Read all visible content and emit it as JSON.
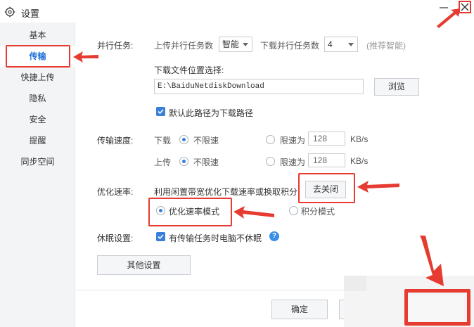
{
  "window": {
    "title": "设置"
  },
  "sidebar": {
    "items": [
      {
        "label": "基本"
      },
      {
        "label": "传输"
      },
      {
        "label": "快捷上传"
      },
      {
        "label": "隐私"
      },
      {
        "label": "安全"
      },
      {
        "label": "提醒"
      },
      {
        "label": "同步空间"
      }
    ],
    "active_index": 1
  },
  "parallel": {
    "label": "并行任务:",
    "upload_label": "上传并行任务数",
    "upload_value": "智能",
    "download_label": "下载并行任务数",
    "download_value": "4",
    "hint": "(推荐智能)"
  },
  "download_location": {
    "label": "下载文件位置选择:",
    "path": "E:\\BaiduNetdiskDownload",
    "browse_button": "浏览",
    "default_checkbox_label": "默认此路径为下载路径",
    "default_checked": true
  },
  "speed": {
    "label": "传输速度:",
    "download_label": "下载",
    "upload_label": "上传",
    "unlimited_label": "不限速",
    "limit_label": "限速为",
    "download_limit_value": "128",
    "upload_limit_value": "128",
    "unit": "KB/s"
  },
  "optimize": {
    "label": "优化速率:",
    "description": "利用闲置带宽优化下载速率或换取积分",
    "close_button": "去关闭",
    "mode_optimize": "优化速率模式",
    "mode_points": "积分模式",
    "selected": "优化速率模式"
  },
  "sleep": {
    "label": "休眠设置:",
    "checkbox_label": "有传输任务时电脑不休眠",
    "checked": true
  },
  "other_button": "其他设置",
  "footer": {
    "ok_button": "确定"
  },
  "colors": {
    "accent": "#3a7fd9",
    "annotation": "#e53b30",
    "active_tab": "#1e6fd9"
  }
}
